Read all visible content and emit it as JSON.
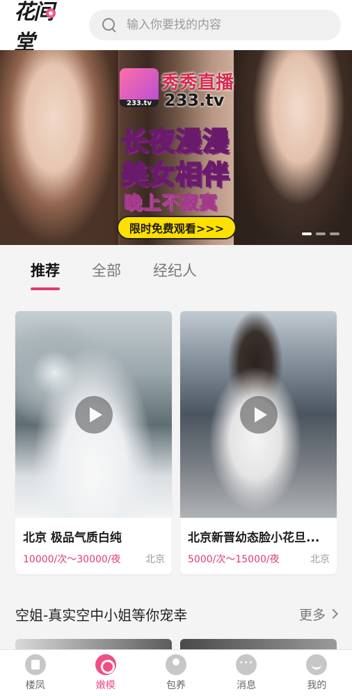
{
  "header": {
    "logo_text": "花间堂",
    "search_placeholder": "输入你要找的内容"
  },
  "banner": {
    "badge_label": "233.tv",
    "brand_name": "秀秀直播",
    "brand_domain": "233.tv",
    "line1": "长夜漫漫",
    "line2": "美女相伴",
    "line3": "晚上不寂寞",
    "cta": "限时免费观看>>>",
    "slide_count": 3,
    "active_slide": 1
  },
  "tabs": [
    {
      "label": "推荐",
      "active": true
    },
    {
      "label": "全部",
      "active": false
    },
    {
      "label": "经纪人",
      "active": false
    }
  ],
  "cards": [
    {
      "title": "北京 极品气质白纯",
      "price": "10000/次～30000/夜",
      "city": "北京"
    },
    {
      "title": "北京新晋幼态脸小花旦...",
      "price": "5000/次～15000/夜",
      "city": "北京"
    }
  ],
  "section": {
    "title": "空姐-真实空中小姐等你宠幸",
    "more": "更多"
  },
  "bottom_nav": [
    {
      "label": "楼凤",
      "icon": "building-icon",
      "active": false
    },
    {
      "label": "嫩模",
      "icon": "model-icon",
      "active": true
    },
    {
      "label": "包养",
      "icon": "person-icon",
      "active": false
    },
    {
      "label": "消息",
      "icon": "chat-icon",
      "active": false
    },
    {
      "label": "我的",
      "icon": "profile-icon",
      "active": false
    }
  ],
  "colors": {
    "accent": "#e33a70",
    "nav_active": "#ef4f85",
    "cta_yellow": "#ffe100"
  }
}
